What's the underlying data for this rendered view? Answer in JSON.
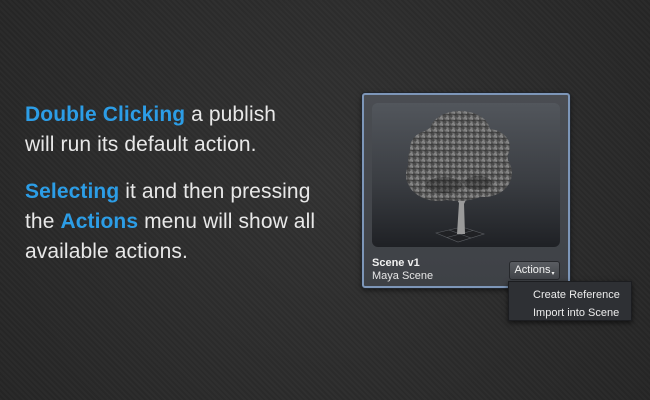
{
  "instructions": {
    "p1": {
      "highlight": "Double Clicking",
      "text_a": " a publish",
      "text_b": "will run its default action."
    },
    "p2": {
      "highlight1": "Selecting",
      "text_a": " it and then pressing",
      "text_b": "the ",
      "highlight2": "Actions",
      "text_c": " menu will show all",
      "text_d": "available actions."
    }
  },
  "publish_item": {
    "thumbnail_icon": "tree-render-icon",
    "title": "Scene v1",
    "subtitle": "Maya Scene",
    "actions_label": "Actions",
    "caret": "▾"
  },
  "actions_menu": {
    "items": [
      {
        "label": "Create Reference"
      },
      {
        "label": "Import into Scene"
      }
    ]
  },
  "colors": {
    "highlight": "#2c9de6",
    "selection_border": "#7d96b8",
    "background": "#2b2b2b"
  }
}
